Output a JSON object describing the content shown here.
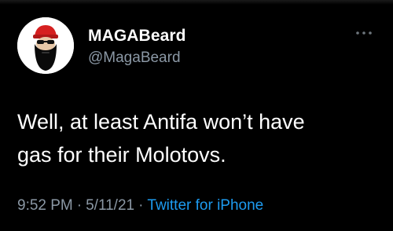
{
  "user": {
    "display_name": "MAGABeard",
    "handle": "@MagaBeard",
    "avatar_icon": "bearded-man-red-cap-avatar"
  },
  "tweet": {
    "text_line_1": "Well, at least Antifa won’t have",
    "text_line_2": "gas for their Molotovs."
  },
  "meta": {
    "time": "9:52 PM",
    "separator": "·",
    "date": "5/11/21",
    "source": "Twitter for iPhone"
  },
  "icons": {
    "more": "more-options-icon"
  },
  "colors": {
    "background": "#000000",
    "primary_text": "#ffffff",
    "secondary_text": "#8b98a5",
    "link": "#1d9bf0",
    "cap_red": "#d62020"
  }
}
